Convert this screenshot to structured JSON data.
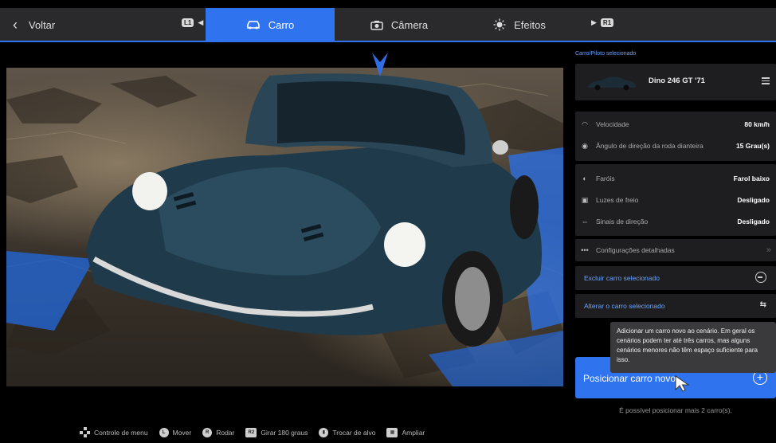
{
  "topbar": {
    "back_label": "Voltar",
    "l1_label": "L1",
    "r1_label": "R1",
    "tabs": [
      {
        "label": "Carro",
        "icon": "car-icon",
        "active": true
      },
      {
        "label": "Câmera",
        "icon": "camera-icon",
        "active": false
      },
      {
        "label": "Efeitos",
        "icon": "sun-icon",
        "active": false
      }
    ],
    "accent": "#2f73ee"
  },
  "panel": {
    "section_label": "Carro/Piloto selecionado",
    "car_name": "Dino 246 GT '71",
    "stats": [
      {
        "icon": "speedometer-icon",
        "label": "Velocidade",
        "value": "80 km/h"
      },
      {
        "icon": "steering-icon",
        "label": "Ângulo de direção da roda dianteira",
        "value": "15 Grau(s)"
      }
    ],
    "lights": [
      {
        "icon": "headlight-icon",
        "label": "Faróis",
        "value": "Farol baixo"
      },
      {
        "icon": "brake-light-icon",
        "label": "Luzes de freio",
        "value": "Desligado"
      },
      {
        "icon": "turn-signal-icon",
        "label": "Sinais de direção",
        "value": "Desligado"
      }
    ],
    "detailed_settings": "Configurações detalhadas",
    "delete_car": "Excluir carro selecionado",
    "change_car": "Alterar o carro selecionado",
    "place_new_car": "Posicionar carro novo",
    "tooltip": "Adicionar um carro novo ao cenário. Em geral os cenários podem ter até três carros, mas alguns cenários menores não têm espaço suficiente para isso.",
    "note": "É possível posicionar mais 2 carro(s)."
  },
  "legend": [
    {
      "icon": "dpad-icon",
      "btn": "",
      "label": "Controle de menu"
    },
    {
      "icon": "left-stick-icon",
      "btn": "L",
      "label": "Mover"
    },
    {
      "icon": "right-stick-icon",
      "btn": "R",
      "label": "Rodar"
    },
    {
      "icon": "r2-button-icon",
      "btn": "R2",
      "label": "Girar 180 graus"
    },
    {
      "icon": "touchpad-icon",
      "btn": "▮",
      "label": "Trocar de alvo"
    },
    {
      "icon": "keyboard-icon",
      "btn": "▦",
      "label": "Ampliar"
    }
  ]
}
